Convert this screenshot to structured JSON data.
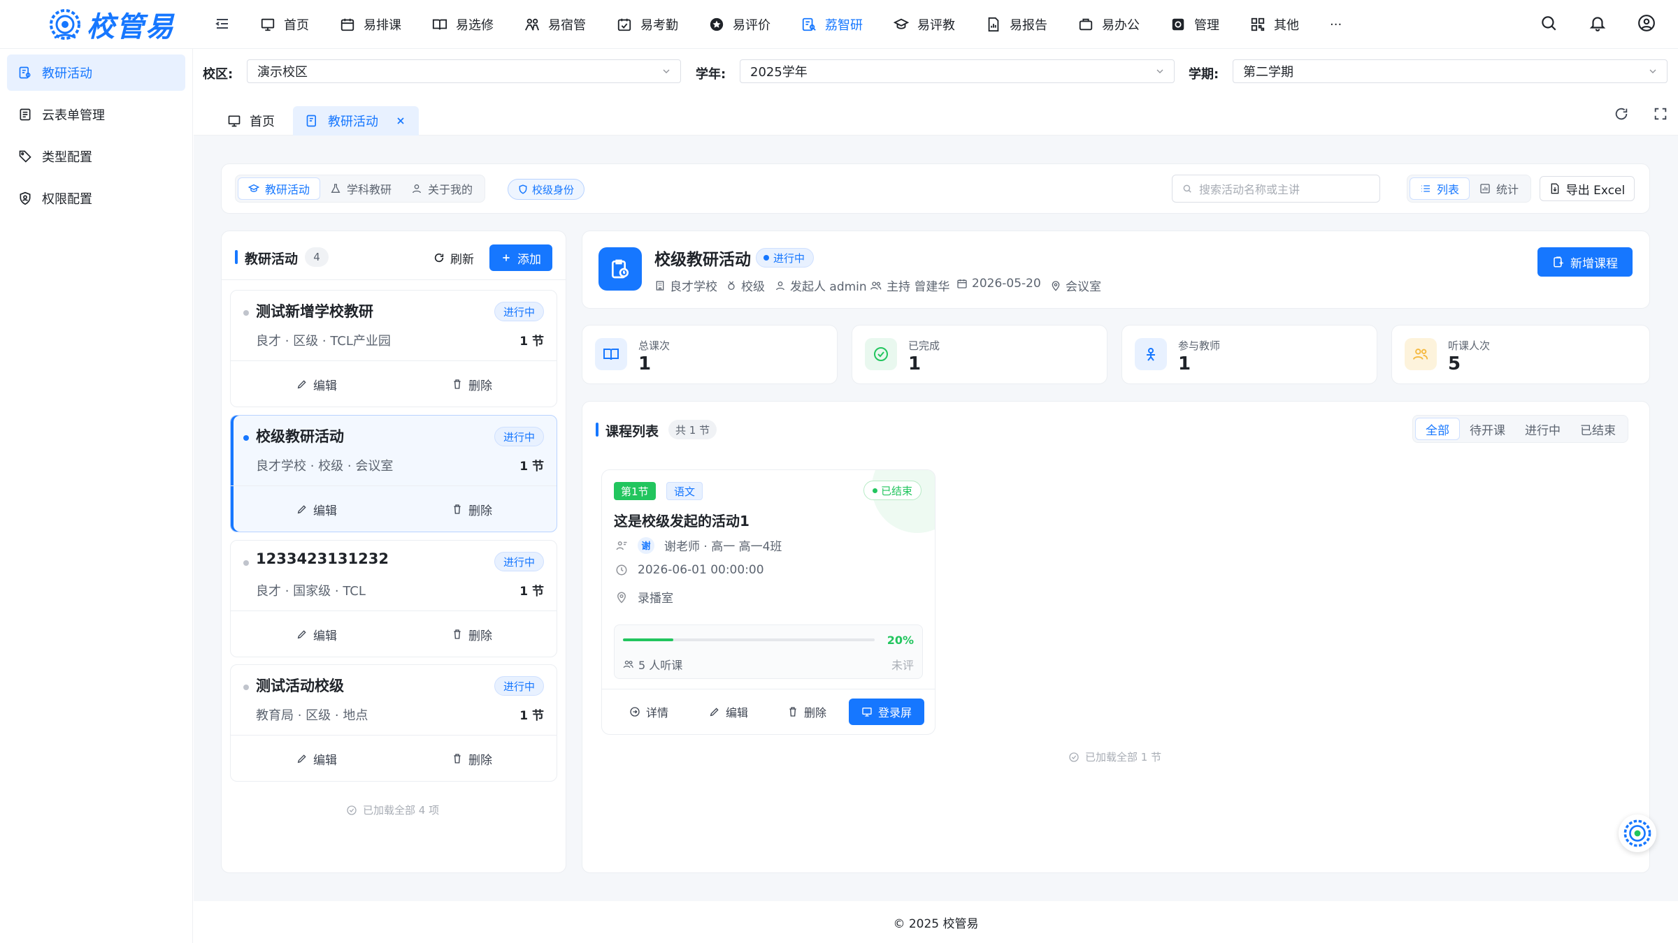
{
  "brand": {
    "name": "校管易"
  },
  "nav": {
    "items": [
      {
        "label": "首页",
        "icon": "monitor-icon"
      },
      {
        "label": "易排课",
        "icon": "calendar-icon"
      },
      {
        "label": "易选修",
        "icon": "book-open-icon"
      },
      {
        "label": "易宿管",
        "icon": "people-icon"
      },
      {
        "label": "易考勤",
        "icon": "calendar-check-icon"
      },
      {
        "label": "易评价",
        "icon": "star-icon"
      },
      {
        "label": "荔智研",
        "icon": "research-icon",
        "active": true
      },
      {
        "label": "易评教",
        "icon": "graduation-cap-icon"
      },
      {
        "label": "易报告",
        "icon": "report-icon"
      },
      {
        "label": "易办公",
        "icon": "briefcase-icon"
      },
      {
        "label": "管理",
        "icon": "gear-icon"
      },
      {
        "label": "其他",
        "icon": "grid-icon"
      }
    ],
    "more": "···"
  },
  "sidebar": {
    "items": [
      {
        "label": "教研活动",
        "icon": "research-icon",
        "active": true
      },
      {
        "label": "云表单管理",
        "icon": "form-icon"
      },
      {
        "label": "类型配置",
        "icon": "tag-icon"
      },
      {
        "label": "权限配置",
        "icon": "shield-user-icon"
      }
    ]
  },
  "filters": {
    "campus_label": "校区:",
    "campus_value": "演示校区",
    "year_label": "学年:",
    "year_value": "2025学年",
    "term_label": "学期:",
    "term_value": "第二学期"
  },
  "tabs": {
    "home": "首页",
    "current": "教研活动"
  },
  "toolbar": {
    "seg": [
      "教研活动",
      "学科教研",
      "关于我的"
    ],
    "identity": "校级身份",
    "search_placeholder": "搜索活动名称或主讲",
    "view_list": "列表",
    "view_stats": "统计",
    "export": "导出 Excel"
  },
  "list": {
    "title": "教研活动",
    "count": "4",
    "refresh": "刷新",
    "add": "添加",
    "edit": "编辑",
    "delete": "删除",
    "footer": "已加载全部 4 项",
    "items": [
      {
        "title": "测试新增学校教研",
        "status": "进行中",
        "sub": "良才 · 区级 · TCL产业园",
        "count": "1 节"
      },
      {
        "title": "校级教研活动",
        "status": "进行中",
        "sub": "良才学校 · 校级 · 会议室",
        "count": "1 节",
        "selected": true
      },
      {
        "title": "1233423131232",
        "status": "进行中",
        "sub": "良才 · 国家级 · TCL",
        "count": "1 节"
      },
      {
        "title": "测试活动校级",
        "status": "进行中",
        "sub": "教育局 · 区级 · 地点",
        "count": "1 节"
      }
    ]
  },
  "detail": {
    "title": "校级教研活动",
    "status": "进行中",
    "meta": {
      "school": "良才学校",
      "level": "校级",
      "initiator": "发起人 admin",
      "host": "主持 曾建华",
      "date": "2026-05-20",
      "place": "会议室"
    },
    "new_course": "新增课程",
    "stats": [
      {
        "label": "总课次",
        "value": "1"
      },
      {
        "label": "已完成",
        "value": "1"
      },
      {
        "label": "参与教师",
        "value": "1"
      },
      {
        "label": "听课人次",
        "value": "5"
      }
    ],
    "courses_title": "课程列表",
    "courses_count": "共 1 节",
    "filters": [
      "全部",
      "待开课",
      "进行中",
      "已结束"
    ],
    "course": {
      "lesson": "第1节",
      "subject": "语文",
      "status": "已结束",
      "title": "这是校级发起的活动1",
      "teacher_avatar": "谢",
      "teacher": "谢老师 · 高一 高一4班",
      "time": "2026-06-01 00:00:00",
      "place": "录播室",
      "progress_label": "20%",
      "progress": 0.2,
      "listeners": "5 人听课",
      "eval": "未评",
      "detail": "详情",
      "edit": "编辑",
      "delete": "删除",
      "screen": "登录屏"
    },
    "footer": "已加载全部 1 节"
  },
  "footer": "© 2025 校管易",
  "colors": {
    "primary": "#1677ff",
    "success": "#22c55e",
    "amber": "#f5b83d"
  }
}
